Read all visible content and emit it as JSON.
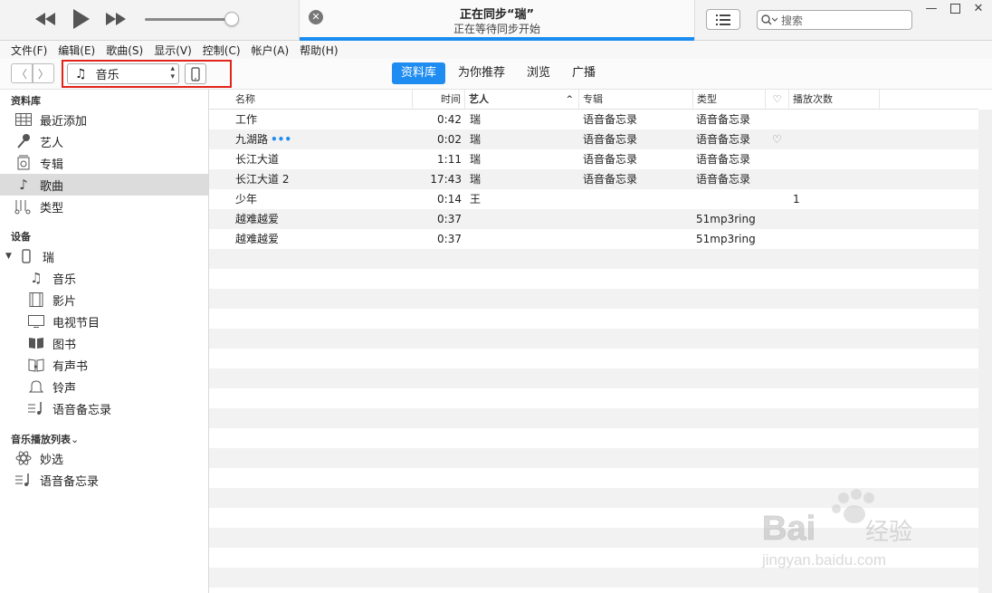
{
  "sync": {
    "title": "正在同步“瑞”",
    "subtitle": "正在等待同步开始",
    "progress": 1.0
  },
  "search": {
    "placeholder": "搜索"
  },
  "menu": [
    "文件(F)",
    "编辑(E)",
    "歌曲(S)",
    "显示(V)",
    "控制(C)",
    "帐户(A)",
    "帮助(H)"
  ],
  "toolbar": {
    "media_kind": "音乐",
    "tabs": [
      {
        "label": "资料库",
        "active": true
      },
      {
        "label": "为你推荐",
        "active": false
      },
      {
        "label": "浏览",
        "active": false
      },
      {
        "label": "广播",
        "active": false
      }
    ]
  },
  "sidebar": {
    "library_head": "资料库",
    "library": [
      {
        "label": "最近添加",
        "icon": "grid-icon"
      },
      {
        "label": "艺人",
        "icon": "microphone-icon"
      },
      {
        "label": "专辑",
        "icon": "album-icon"
      },
      {
        "label": "歌曲",
        "icon": "music-note-icon",
        "selected": true
      },
      {
        "label": "类型",
        "icon": "genre-icon"
      }
    ],
    "devices_head": "设备",
    "device_name": "瑞",
    "device_items": [
      {
        "label": "音乐",
        "icon": "music-note-icon"
      },
      {
        "label": "影片",
        "icon": "film-icon"
      },
      {
        "label": "电视节目",
        "icon": "tv-icon"
      },
      {
        "label": "图书",
        "icon": "book-icon"
      },
      {
        "label": "有声书",
        "icon": "audiobook-icon"
      },
      {
        "label": "铃声",
        "icon": "bell-icon"
      },
      {
        "label": "语音备忘录",
        "icon": "voice-memo-icon"
      }
    ],
    "playlists_head": "音乐播放列表",
    "playlists": [
      {
        "label": "妙选",
        "icon": "genius-icon"
      },
      {
        "label": "语音备忘录",
        "icon": "voice-memo-icon"
      }
    ]
  },
  "table": {
    "headers": {
      "name": "名称",
      "time": "时间",
      "artist": "艺人",
      "album": "专辑",
      "genre": "类型",
      "plays": "播放次数"
    },
    "rows": [
      {
        "name": "工作",
        "time": "0:42",
        "artist": "瑞",
        "album": "语音备忘录",
        "genre": "语音备忘录",
        "plays": ""
      },
      {
        "name": "九湖路",
        "time": "0:02",
        "artist": "瑞",
        "album": "语音备忘录",
        "genre": "语音备忘录",
        "plays": "",
        "more": "•••",
        "heart": true
      },
      {
        "name": "长江大道",
        "time": "1:11",
        "artist": "瑞",
        "album": "语音备忘录",
        "genre": "语音备忘录",
        "plays": ""
      },
      {
        "name": "长江大道 2",
        "time": "17:43",
        "artist": "瑞",
        "album": "语音备忘录",
        "genre": "语音备忘录",
        "plays": ""
      },
      {
        "name": "少年",
        "time": "0:14",
        "artist": "王",
        "album": "",
        "genre": "",
        "plays": "1"
      },
      {
        "name": "越难越爱",
        "time": "0:37",
        "artist": "",
        "album": "",
        "genre": "51mp3ring",
        "plays": ""
      },
      {
        "name": "越难越爱",
        "time": "0:37",
        "artist": "",
        "album": "",
        "genre": "51mp3ring",
        "plays": ""
      }
    ]
  },
  "watermark": {
    "brand": "Baidu经验",
    "url": "jingyan.baidu.com"
  }
}
